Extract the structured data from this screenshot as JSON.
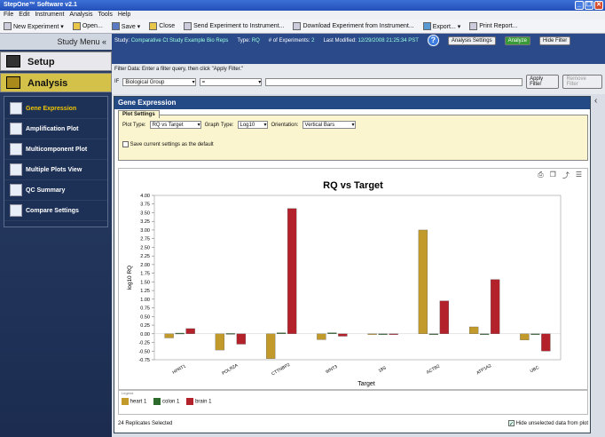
{
  "window": {
    "title": "StepOne™ Software v2.1"
  },
  "menu": [
    "File",
    "Edit",
    "Instrument",
    "Analysis",
    "Tools",
    "Help"
  ],
  "toolbar": {
    "new_experiment": "New Experiment ▾",
    "open": "Open...",
    "save": "Save ▾",
    "close": "Close",
    "send": "Send Experiment to Instrument...",
    "download": "Download Experiment from Instrument...",
    "export": "Export... ▾",
    "print": "Print Report..."
  },
  "sidebar": {
    "header": "Study Menu «",
    "setup": "Setup",
    "analysis": "Analysis",
    "items": [
      {
        "label": "Gene Expression"
      },
      {
        "label": "Amplification Plot"
      },
      {
        "label": "Multicomponent Plot"
      },
      {
        "label": "Multiple Plots View"
      },
      {
        "label": "QC Summary"
      },
      {
        "label": "Compare Settings"
      }
    ]
  },
  "study": {
    "study_label": "Study:",
    "study_value": "Comparative Ct Study Example Bio Reps",
    "type_label": "Type:",
    "type_value": "RQ",
    "num_label": "# of Experiments:",
    "num_value": "2",
    "modified_label": "Last Modified:",
    "modified_value": "12/29/2008 21:25:34 PST",
    "analysis_settings": "Analysis Settings",
    "analyze": "Analyze",
    "hide_filter": "Hide Filter"
  },
  "filter": {
    "instruction": "Filter Data: Enter a filter query, then click \"Apply Filter.\"",
    "if_label": "IF",
    "field": "Biological Group",
    "operator": "=",
    "apply": "Apply Filter",
    "remove": "Remove Filter"
  },
  "panel": {
    "title": "Gene Expression",
    "tab": "Plot Settings",
    "plot_type_label": "Plot Type:",
    "plot_type": "RQ vs Target",
    "graph_type_label": "Graph Type:",
    "graph_type": "Log10",
    "orientation_label": "Orientation:",
    "orientation": "Vertical Bars",
    "save_default": "Save current settings as the default",
    "legend_title": "Legend",
    "replicates": "24 Replicates Selected",
    "hide_unselected": "Hide unselected data from plot"
  },
  "colors": {
    "heart": "#c29a2c",
    "colon": "#2d6b2d",
    "brain": "#b3212b"
  },
  "chart_data": {
    "type": "bar",
    "title": "RQ vs Target",
    "xlabel": "Target",
    "ylabel": "log10 RQ",
    "ylim": [
      -0.75,
      4.0
    ],
    "yticks": [
      "4.00",
      "3.75",
      "3.50",
      "3.25",
      "3.00",
      "2.75",
      "2.50",
      "2.25",
      "2.00",
      "1.75",
      "1.50",
      "1.25",
      "1.00",
      "0.75",
      "0.50",
      "0.25",
      "0.00",
      "-0.25",
      "-0.50",
      "-0.75"
    ],
    "categories": [
      "HPRT1",
      "POLR2A",
      "CTTNBP2",
      "WNT3",
      "18S",
      "ACTB2",
      "ATP1A2",
      "UBC"
    ],
    "series": [
      {
        "name": "heart 1",
        "values": [
          -0.12,
          -0.47,
          -0.72,
          -0.17,
          0.0,
          3.0,
          0.2,
          -0.18
        ]
      },
      {
        "name": "colon 1",
        "values": [
          0.02,
          0.01,
          0.03,
          0.03,
          0.0,
          0.0,
          0.0,
          0.0
        ]
      },
      {
        "name": "brain 1",
        "values": [
          0.15,
          -0.3,
          3.62,
          -0.07,
          0.0,
          0.95,
          1.57,
          -0.5
        ]
      }
    ]
  }
}
